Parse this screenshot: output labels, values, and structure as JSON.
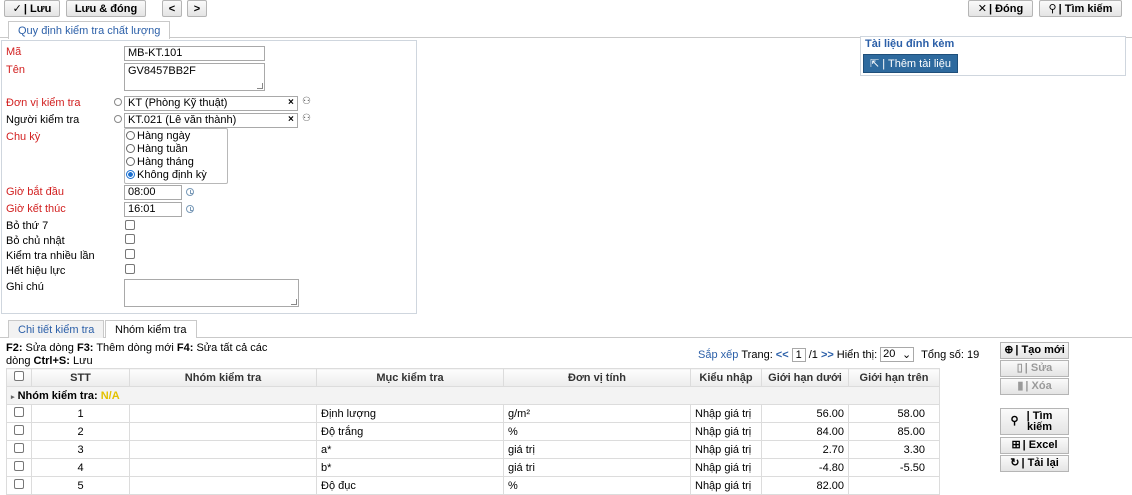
{
  "toolbar": {
    "save": "| Lưu",
    "save_close": "Lưu & đóng",
    "prev": "<",
    "next": ">",
    "close": "| Đóng",
    "search": "| Tìm kiếm"
  },
  "tabs_top": {
    "main": "Quy định kiểm tra chất lượng"
  },
  "form": {
    "ma_label": "Mã",
    "ma_value": "MB-KT.101",
    "ten_label": "Tên",
    "ten_value": "GV8457BB2F",
    "donvi_label": "Đơn vị kiểm tra",
    "donvi_value": "KT (Phòng Kỹ thuật)",
    "nguoi_label": "Người kiểm tra",
    "nguoi_value": "KT.021 (Lê văn thành)",
    "chuky_label": "Chu kỳ",
    "chuky_options": [
      "Hàng ngày",
      "Hàng tuần",
      "Hàng tháng",
      "Không định kỳ"
    ],
    "chuky_selected": "Không định kỳ",
    "giobatdau_label": "Giờ bắt đầu",
    "giobatdau_value": "08:00",
    "gioketthuc_label": "Giờ kết thúc",
    "gioketthuc_value": "16:01",
    "bothu7_label": "Bỏ thứ 7",
    "bochunhat_label": "Bỏ chủ nhật",
    "nhieulan_label": "Kiểm tra nhiều lần",
    "hethieuluc_label": "Hết hiệu lực",
    "ghichu_label": "Ghi chú",
    "ghichu_value": ""
  },
  "attach": {
    "title": "Tài liệu đính kèm",
    "add": "| Thêm tài liệu"
  },
  "tabs_bottom": {
    "detail": "Chi tiết kiểm tra",
    "group": "Nhóm kiểm tra"
  },
  "hint": {
    "k1": "F2:",
    "t1": " Sửa dòng ",
    "k2": "F3:",
    "t2": " Thêm dòng mới ",
    "k3": "F4:",
    "t3": " Sửa tất cả các dòng ",
    "k4": "Ctrl+S:",
    "t4": " Lưu"
  },
  "pager": {
    "sort": "Sắp xếp",
    "page_label": "Trang:",
    "first": "<<",
    "page": "1",
    "total_pages": "/1",
    "last": ">>",
    "show_label": "Hiển thị:",
    "page_size": "20",
    "total_label": "Tổng số:",
    "total": "19"
  },
  "grid": {
    "headers": [
      "STT",
      "Nhóm kiểm tra",
      "Mục kiểm tra",
      "Đơn vị tính",
      "Kiểu nhập",
      "Giới hạn dưới",
      "Giới hạn trên"
    ],
    "group_label": "Nhóm kiểm tra:",
    "group_value": "N/A",
    "rows": [
      {
        "stt": "1",
        "nhom": "",
        "muc": "Định lượng",
        "dvt": "g/m²",
        "kieu": "Nhập giá trị",
        "duoi": "56.00",
        "tren": "58.00"
      },
      {
        "stt": "2",
        "nhom": "",
        "muc": "Độ trắng",
        "dvt": "%",
        "kieu": "Nhập giá trị",
        "duoi": "84.00",
        "tren": "85.00"
      },
      {
        "stt": "3",
        "nhom": "",
        "muc": "a*",
        "dvt": "giá trị",
        "kieu": "Nhập giá trị",
        "duoi": "2.70",
        "tren": "3.30"
      },
      {
        "stt": "4",
        "nhom": "",
        "muc": "b*",
        "dvt": "giá tri",
        "kieu": "Nhập giá trị",
        "duoi": "-4.80",
        "tren": "-5.50"
      },
      {
        "stt": "5",
        "nhom": "",
        "muc": "Độ đục",
        "dvt": "%",
        "kieu": "Nhập giá trị",
        "duoi": "82.00",
        "tren": ""
      }
    ]
  },
  "side_buttons": {
    "new": "| Tạo mới",
    "edit": "| Sửa",
    "delete": "| Xóa",
    "search": "| Tìm kiếm",
    "excel": "| Excel",
    "reload": "| Tải lại"
  },
  "colors": {
    "required": "#d21f1f",
    "accent": "#2b5fa8",
    "group_value": "#e3c200",
    "attach_button": "#2e6a9e"
  }
}
